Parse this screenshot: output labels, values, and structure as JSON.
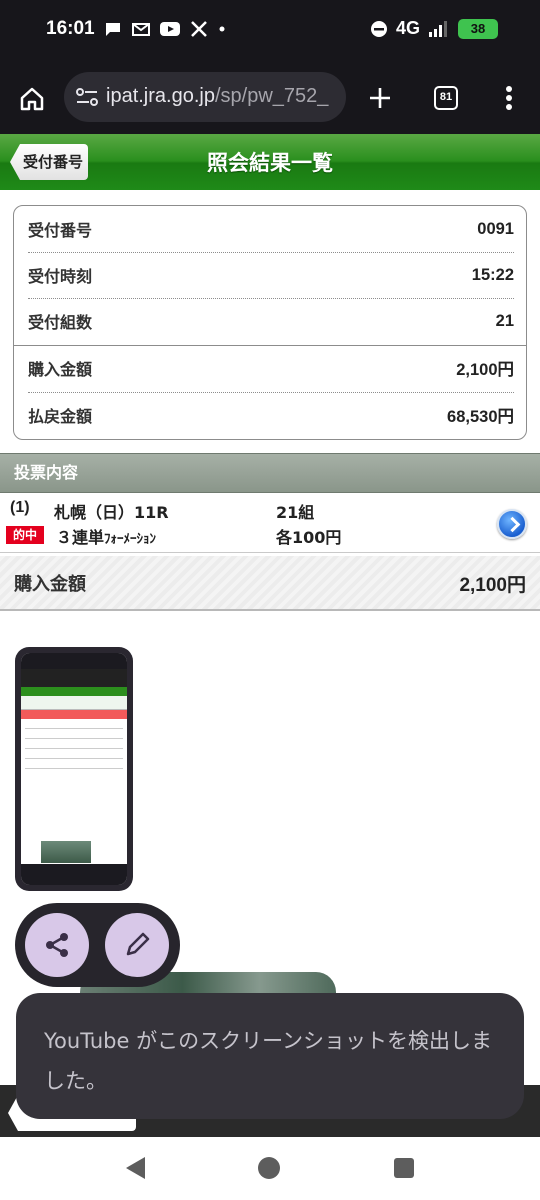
{
  "status_bar": {
    "time": "16:01",
    "network": "4G",
    "battery": "38"
  },
  "browser": {
    "url_host": "ipat.jra.go.jp",
    "url_path": "/sp/pw_752_",
    "tab_count": "81"
  },
  "header": {
    "back_label": "受付番号",
    "title": "照会結果一覧"
  },
  "summary": {
    "rows": [
      {
        "label": "受付番号",
        "value": "0091"
      },
      {
        "label": "受付時刻",
        "value": "15:22"
      },
      {
        "label": "受付組数",
        "value": "21"
      },
      {
        "label": "購入金額",
        "value": "2,100円"
      },
      {
        "label": "払戻金額",
        "value": "68,530円"
      }
    ]
  },
  "votes": {
    "section_title": "投票内容",
    "items": [
      {
        "index": "(1)",
        "race": "札幌（日）11R",
        "combos": "21組",
        "hit_badge": "的中",
        "bet_type_main": "３連単",
        "bet_type_sub": "ﾌｫｰﾒｰｼｮﾝ",
        "amount": "各100円"
      }
    ]
  },
  "total": {
    "label": "購入金額",
    "value": "2,100円"
  },
  "toast": {
    "message": "YouTube がこのスクリーンショットを検出しました。"
  },
  "colors": {
    "header_green": "#2a8f1e",
    "hit_red": "#e4001e",
    "section_gray": "#98a398",
    "toast_bg": "#35333a"
  }
}
